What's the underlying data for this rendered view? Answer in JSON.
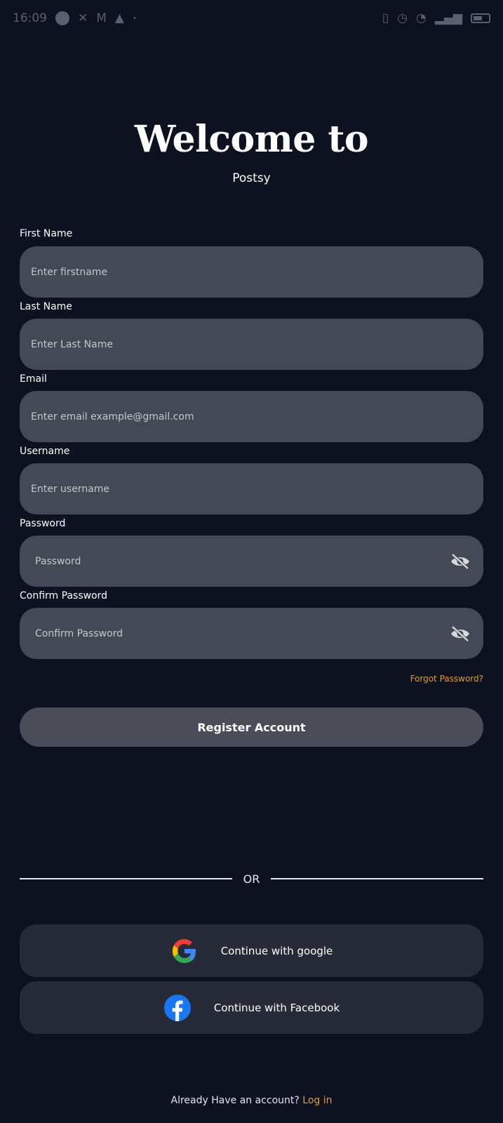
{
  "status_bar": {
    "time": "16:09",
    "left_icons": [
      "notification-circle-icon",
      "x-app-icon",
      "gmail-icon",
      "bell-icon",
      "dot-icon"
    ],
    "right_icons": [
      "vibrate-icon",
      "alarm-icon",
      "wifi-icon",
      "signal-icon",
      "battery-icon"
    ]
  },
  "header": {
    "title": "Welcome to",
    "subtitle": "Postsy"
  },
  "form": {
    "first_name": {
      "label": "First Name",
      "placeholder": "Enter firstname"
    },
    "last_name": {
      "label": "Last Name",
      "placeholder": "Enter Last Name"
    },
    "email": {
      "label": "Email",
      "placeholder": "Enter email example@gmail.com"
    },
    "username": {
      "label": "Username",
      "placeholder": "Enter username"
    },
    "password": {
      "label": "Password",
      "placeholder": "Password",
      "icon": "eye-off-icon"
    },
    "confirm_password": {
      "label": "Confirm Password",
      "placeholder": "Confirm Password",
      "icon": "eye-off-icon"
    },
    "forgot_password": "Forgot Password?",
    "register_label": "Register Account"
  },
  "divider": {
    "text": "OR"
  },
  "social": {
    "google": {
      "label": "Continue with google",
      "icon": "google-icon"
    },
    "facebook": {
      "label": "Continue with Facebook",
      "icon": "facebook-icon"
    }
  },
  "footer": {
    "prompt": "Already Have an account?",
    "login_label": "Log in"
  },
  "colors": {
    "background": "#0d1220",
    "field": "#454955",
    "register_button": "#4a4d57",
    "social_button": "#272b38",
    "accent": "#e09a3a"
  }
}
